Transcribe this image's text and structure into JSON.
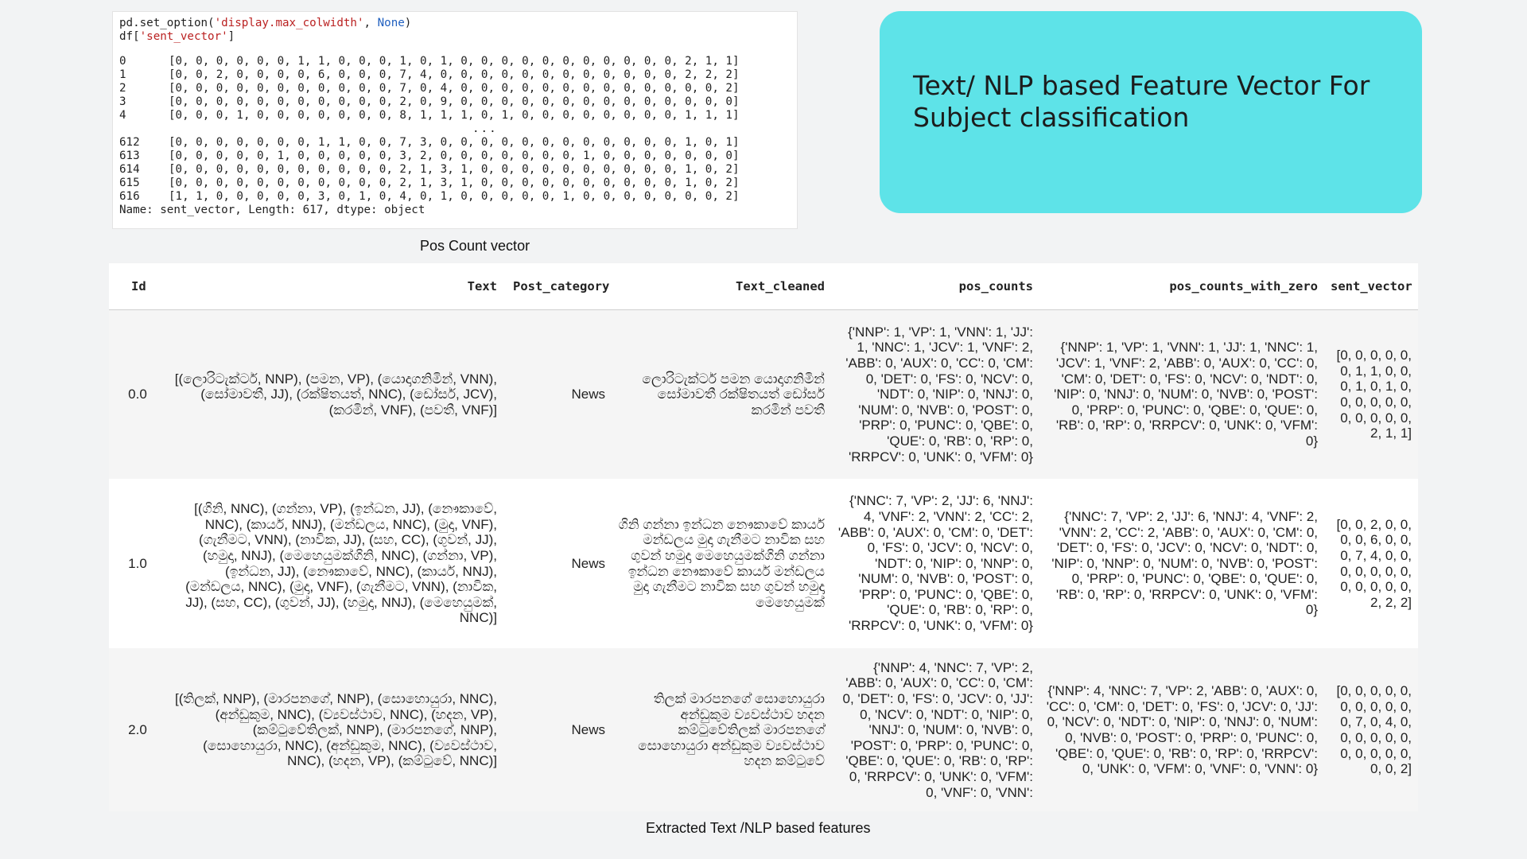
{
  "code": {
    "line1_prefix": "pd.set_option(",
    "line1_str": "'display.max_colwidth'",
    "line1_sep": ", ",
    "line1_kw": "None",
    "line1_suffix": ")",
    "line2_prefix": "df[",
    "line2_str": "'sent_vector'",
    "line2_suffix": "]",
    "rows_top": [
      {
        "idx": "0",
        "vec": "[0, 0, 0, 0, 0, 0, 1, 1, 0, 0, 0, 1, 0, 1, 0, 0, 0, 0, 0, 0, 0, 0, 0, 0, 0, 2, 1, 1]"
      },
      {
        "idx": "1",
        "vec": "[0, 0, 2, 0, 0, 0, 0, 6, 0, 0, 0, 7, 4, 0, 0, 0, 0, 0, 0, 0, 0, 0, 0, 0, 0, 2, 2, 2]"
      },
      {
        "idx": "2",
        "vec": "[0, 0, 0, 0, 0, 0, 0, 0, 0, 0, 0, 7, 0, 4, 0, 0, 0, 0, 0, 0, 0, 0, 0, 0, 0, 0, 0, 2]"
      },
      {
        "idx": "3",
        "vec": "[0, 0, 0, 0, 0, 0, 0, 0, 0, 0, 0, 2, 0, 9, 0, 0, 0, 0, 0, 0, 0, 0, 0, 0, 0, 0, 0, 0]"
      },
      {
        "idx": "4",
        "vec": "[0, 0, 0, 1, 0, 0, 0, 0, 0, 0, 0, 8, 1, 1, 1, 0, 1, 0, 0, 0, 0, 0, 0, 0, 0, 1, 1, 1]"
      }
    ],
    "ellipsis": "...",
    "rows_bottom": [
      {
        "idx": "612",
        "vec": "[0, 0, 0, 0, 0, 0, 0, 1, 1, 0, 0, 7, 3, 0, 0, 0, 0, 0, 0, 0, 0, 0, 0, 0, 0, 1, 0, 1]"
      },
      {
        "idx": "613",
        "vec": "[0, 0, 0, 0, 0, 1, 0, 0, 0, 0, 0, 3, 2, 0, 0, 0, 0, 0, 0, 0, 1, 0, 0, 0, 0, 0, 0, 0]"
      },
      {
        "idx": "614",
        "vec": "[0, 0, 0, 0, 0, 0, 0, 0, 0, 0, 0, 2, 1, 3, 1, 0, 0, 0, 0, 0, 0, 0, 0, 0, 0, 1, 0, 2]"
      },
      {
        "idx": "615",
        "vec": "[0, 0, 0, 0, 0, 0, 0, 0, 0, 0, 0, 2, 1, 3, 1, 0, 0, 0, 0, 0, 0, 0, 0, 0, 0, 1, 0, 2]"
      },
      {
        "idx": "616",
        "vec": "[1, 1, 0, 0, 0, 0, 0, 3, 0, 1, 0, 4, 0, 1, 0, 0, 0, 0, 0, 1, 0, 0, 0, 0, 0, 0, 0, 2]"
      }
    ],
    "footer": "Name: sent_vector, Length: 617, dtype: object"
  },
  "captions": {
    "pos_count": "Pos Count vector",
    "extracted": "Extracted Text /NLP based features"
  },
  "title_card": {
    "line1": "Text/ NLP based Feature Vector For",
    "line2": "Subject classification",
    "color": "#5ee3e8"
  },
  "table": {
    "headers": {
      "id": "Id",
      "text": "Text",
      "post_category": "Post_category",
      "text_cleaned": "Text_cleaned",
      "pos_counts": "pos_counts",
      "pos_counts_with_zero": "pos_counts_with_zero",
      "sent_vector": "sent_vector"
    },
    "rows": [
      {
        "id": "0.0",
        "text": "[(ලොරිටැක්ටර්, NNP), (පමන, VP), (යොදාගනිමින්, VNN), (සෝමාවතී, JJ), (රක්ෂිතයත්, NNC), (ඩෝසර්, JCV), (කරමින්, VNF), (පවතී, VNF)]",
        "post_category": "News",
        "text_cleaned": "ලොරිටැක්ටර් පමන යොදාගනිමින් සෝමාවතී රක්ෂිතයත් ඩෝසර් කරමින් පවතී",
        "pos_counts": "{'NNP': 1, 'VP': 1, 'VNN': 1, 'JJ': 1, 'NNC': 1, 'JCV': 1, 'VNF': 2, 'ABB': 0, 'AUX': 0, 'CC': 0, 'CM': 0, 'DET': 0, 'FS': 0, 'NCV': 0, 'NDT': 0, 'NIP': 0, 'NNJ': 0, 'NUM': 0, 'NVB': 0, 'POST': 0, 'PRP': 0, 'PUNC': 0, 'QBE': 0, 'QUE': 0, 'RB': 0, 'RP': 0, 'RRPCV': 0, 'UNK': 0, 'VFM': 0}",
        "pos_counts_with_zero": "{'NNP': 1, 'VP': 1, 'VNN': 1, 'JJ': 1, 'NNC': 1, 'JCV': 1, 'VNF': 2, 'ABB': 0, 'AUX': 0, 'CC': 0, 'CM': 0, 'DET': 0, 'FS': 0, 'NCV': 0, 'NDT': 0, 'NIP': 0, 'NNJ': 0, 'NUM': 0, 'NVB': 0, 'POST': 0, 'PRP': 0, 'PUNC': 0, 'QBE': 0, 'QUE': 0, 'RB': 0, 'RP': 0, 'RRPCV': 0, 'UNK': 0, 'VFM': 0}",
        "sent_vector": "[0, 0, 0, 0, 0, 0, 1, 1, 0, 0, 0, 1, 0, 1, 0, 0, 0, 0, 0, 0, 0, 0, 0, 0, 0, 2, 1, 1]"
      },
      {
        "id": "1.0",
        "text": "[(ගිනි, NNC), (ගන්නා, VP), (ඉන්ධන, JJ), (නෞකාවේ, NNC), (කාර්ය, NNJ), (මන්ඩලය, NNC), (මුදා, VNF), (ගැනීමට, VNN), (නාවික, JJ), (සහ, CC), (ගුවන්, JJ), (හමුදා, NNJ), (මෙහෙයුමක්ගිනි, NNC), (ගන්නා, VP), (ඉන්ධන, JJ), (නෞකාවේ, NNC), (කාර්ය, NNJ), (මන්ඩලය, NNC), (මුදා, VNF), (ගැනීමට, VNN), (නාවික, JJ), (සහ, CC), (ගුවන්, JJ), (හමුදා, NNJ), (මෙහෙයුමක්, NNC)]",
        "post_category": "News",
        "text_cleaned": "ගිනි ගන්නා ඉන්ධන නෞකාවේ කාර්ය මන්ඩලය මුදා ගැනීමට නාවික සහ ගුවන් හමුදා මෙහෙයුමක්ගිනි ගන්නා ඉන්ධන නෞකාවේ කාර්ය මන්ඩලය මුදා ගැනීමට නාවික සහ ගුවන් හමුදා මෙහෙයුමක්",
        "pos_counts": "{'NNC': 7, 'VP': 2, 'JJ': 6, 'NNJ': 4, 'VNF': 2, 'VNN': 2, 'CC': 2, 'ABB': 0, 'AUX': 0, 'CM': 0, 'DET': 0, 'FS': 0, 'JCV': 0, 'NCV': 0, 'NDT': 0, 'NIP': 0, 'NNP': 0, 'NUM': 0, 'NVB': 0, 'POST': 0, 'PRP': 0, 'PUNC': 0, 'QBE': 0, 'QUE': 0, 'RB': 0, 'RP': 0, 'RRPCV': 0, 'UNK': 0, 'VFM': 0}",
        "pos_counts_with_zero": "{'NNC': 7, 'VP': 2, 'JJ': 6, 'NNJ': 4, 'VNF': 2, 'VNN': 2, 'CC': 2, 'ABB': 0, 'AUX': 0, 'CM': 0, 'DET': 0, 'FS': 0, 'JCV': 0, 'NCV': 0, 'NDT': 0, 'NIP': 0, 'NNP': 0, 'NUM': 0, 'NVB': 0, 'POST': 0, 'PRP': 0, 'PUNC': 0, 'QBE': 0, 'QUE': 0, 'RB': 0, 'RP': 0, 'RRPCV': 0, 'UNK': 0, 'VFM': 0}",
        "sent_vector": "[0, 0, 2, 0, 0, 0, 0, 6, 0, 0, 0, 7, 4, 0, 0, 0, 0, 0, 0, 0, 0, 0, 0, 0, 0, 2, 2, 2]"
      },
      {
        "id": "2.0",
        "text": "[(තිලක්, NNP), (මාරපනගේ, NNP), (සොහොයුරා, NNC), (අන්ඩුකුම, NNC), (ව්‍යවස්ථාව, NNC), (හදන, VP), (කම්ටුවේතිලක්, NNP), (මාරපනගේ, NNP), (සොහොයුරා, NNC), (අන්ඩුකුම, NNC), (ව්‍යවස්ථාව, NNC), (හදන, VP), (කම්ටුවේ, NNC)]",
        "post_category": "News",
        "text_cleaned": "තිලක් මාරපනගේ සොහොයුරා අන්ඩුකුම ව්‍යවස්ථාව හදන කම්ටුවේතිලක් මාරපනගේ සොහොයුරා අන්ඩුකුම ව්‍යවස්ථාව හදන කම්ටුවේ",
        "pos_counts": "{'NNP': 4, 'NNC': 7, 'VP': 2, 'ABB': 0, 'AUX': 0, 'CC': 0, 'CM': 0, 'DET': 0, 'FS': 0, 'JCV': 0, 'JJ': 0, 'NCV': 0, 'NDT': 0, 'NIP': 0, 'NNJ': 0, 'NUM': 0, 'NVB': 0, 'POST': 0, 'PRP': 0, 'PUNC': 0, 'QBE': 0, 'QUE': 0, 'RB': 0, 'RP': 0, 'RRPCV': 0, 'UNK': 0, 'VFM': 0, 'VNF': 0, 'VNN':",
        "pos_counts_with_zero": "{'NNP': 4, 'NNC': 7, 'VP': 2, 'ABB': 0, 'AUX': 0, 'CC': 0, 'CM': 0, 'DET': 0, 'FS': 0, 'JCV': 0, 'JJ': 0, 'NCV': 0, 'NDT': 0, 'NIP': 0, 'NNJ': 0, 'NUM': 0, 'NVB': 0, 'POST': 0, 'PRP': 0, 'PUNC': 0, 'QBE': 0, 'QUE': 0, 'RB': 0, 'RP': 0, 'RRPCV': 0, 'UNK': 0, 'VFM': 0, 'VNF': 0, 'VNN': 0}",
        "sent_vector": "[0, 0, 0, 0, 0, 0, 0, 0, 0, 0, 0, 7, 0, 4, 0, 0, 0, 0, 0, 0, 0, 0, 0, 0, 0, 0, 0, 2]"
      }
    ]
  }
}
